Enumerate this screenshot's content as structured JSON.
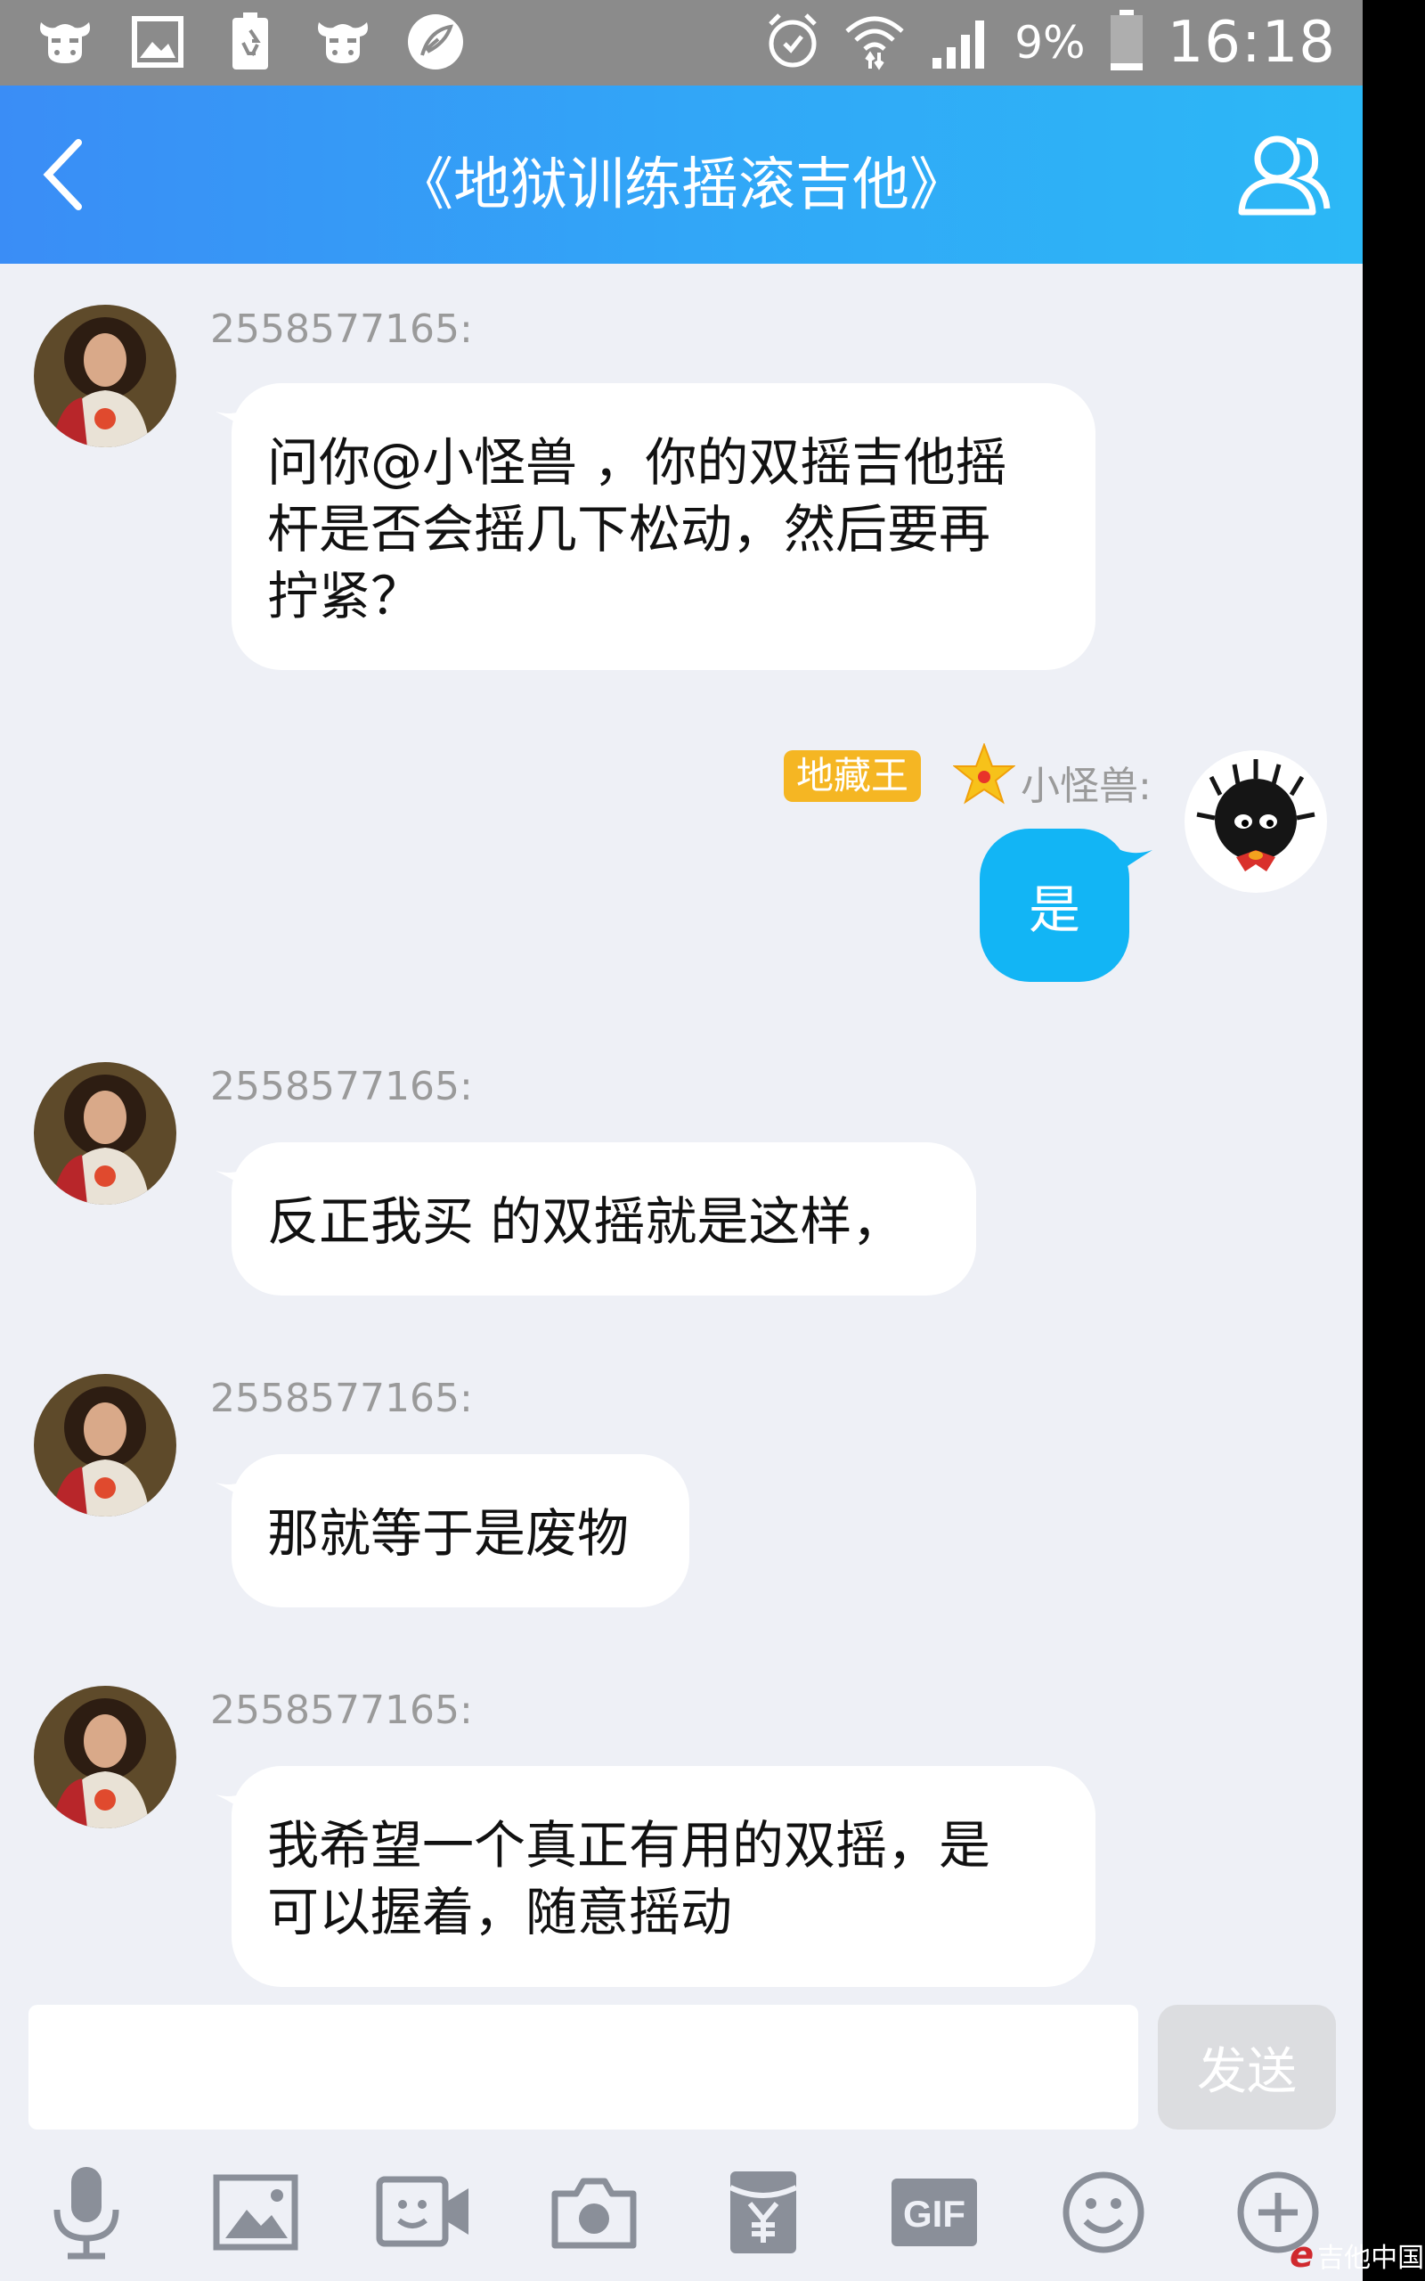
{
  "status_bar": {
    "left_icons": [
      "cow-icon",
      "image-icon",
      "battery-recycle-icon",
      "cow-icon",
      "feather-icon"
    ],
    "battery_percent": "9%",
    "time": "16:18"
  },
  "header": {
    "title": "《地狱训练摇滚吉他》"
  },
  "messages": [
    {
      "sender": "2558577165:",
      "text_lines": [
        "问你@小怪兽 ，你的双摇吉他摇",
        "杆是否会摇几下松动，然后要再",
        "拧紧？"
      ]
    },
    {
      "sender": "小怪兽:",
      "badge": "地藏王",
      "text": "是",
      "self": true
    },
    {
      "sender": "2558577165:",
      "text_lines": [
        "反正我买 的双摇就是这样，"
      ]
    },
    {
      "sender": "2558577165:",
      "text_lines": [
        "那就等于是废物"
      ]
    },
    {
      "sender": "2558577165:",
      "text_lines": [
        "我希望一个真正有用的双摇，是",
        "可以握着，随意摇动"
      ]
    }
  ],
  "input": {
    "value": "",
    "send_label": "发送"
  },
  "toolbar": {
    "icons": [
      "microphone-icon",
      "image-icon",
      "video-call-icon",
      "camera-icon",
      "red-packet-icon",
      "gif-icon",
      "emoji-icon",
      "plus-icon"
    ],
    "gif_label": "GIF"
  },
  "watermark": {
    "text": "吉他中国"
  },
  "colors": {
    "header_gradient_start": "#3a8df6",
    "header_gradient_end": "#2cb8f6",
    "self_bubble": "#12b5f5",
    "badge": "#f5b623",
    "background": "#eef0f6"
  }
}
